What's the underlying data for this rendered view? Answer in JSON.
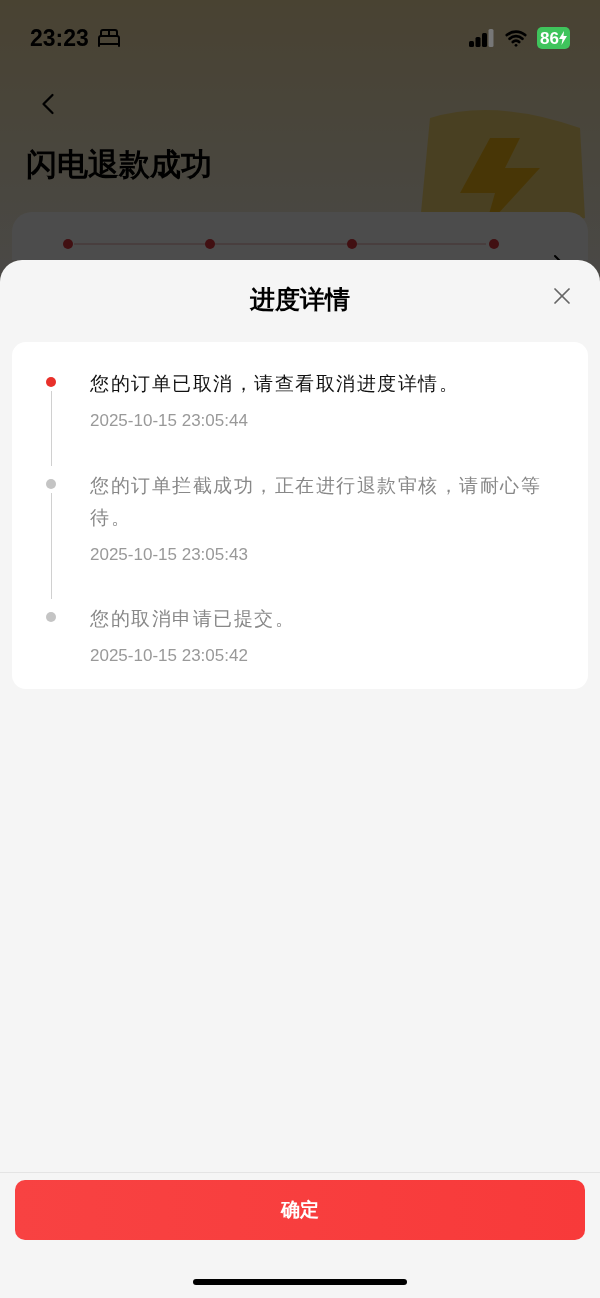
{
  "status_bar": {
    "time": "23:23",
    "battery": "86"
  },
  "page": {
    "title": "闪电退款成功"
  },
  "sheet": {
    "title": "进度详情",
    "timeline": [
      {
        "text": "您的订单已取消，请查看取消进度详情。",
        "time": "2025-10-15 23:05:44",
        "current": true
      },
      {
        "text": "您的订单拦截成功，正在进行退款审核，请耐心等待。",
        "time": "2025-10-15 23:05:43",
        "current": false
      },
      {
        "text": "您的取消申请已提交。",
        "time": "2025-10-15 23:05:42",
        "current": false
      }
    ],
    "confirm_button": "确定"
  }
}
